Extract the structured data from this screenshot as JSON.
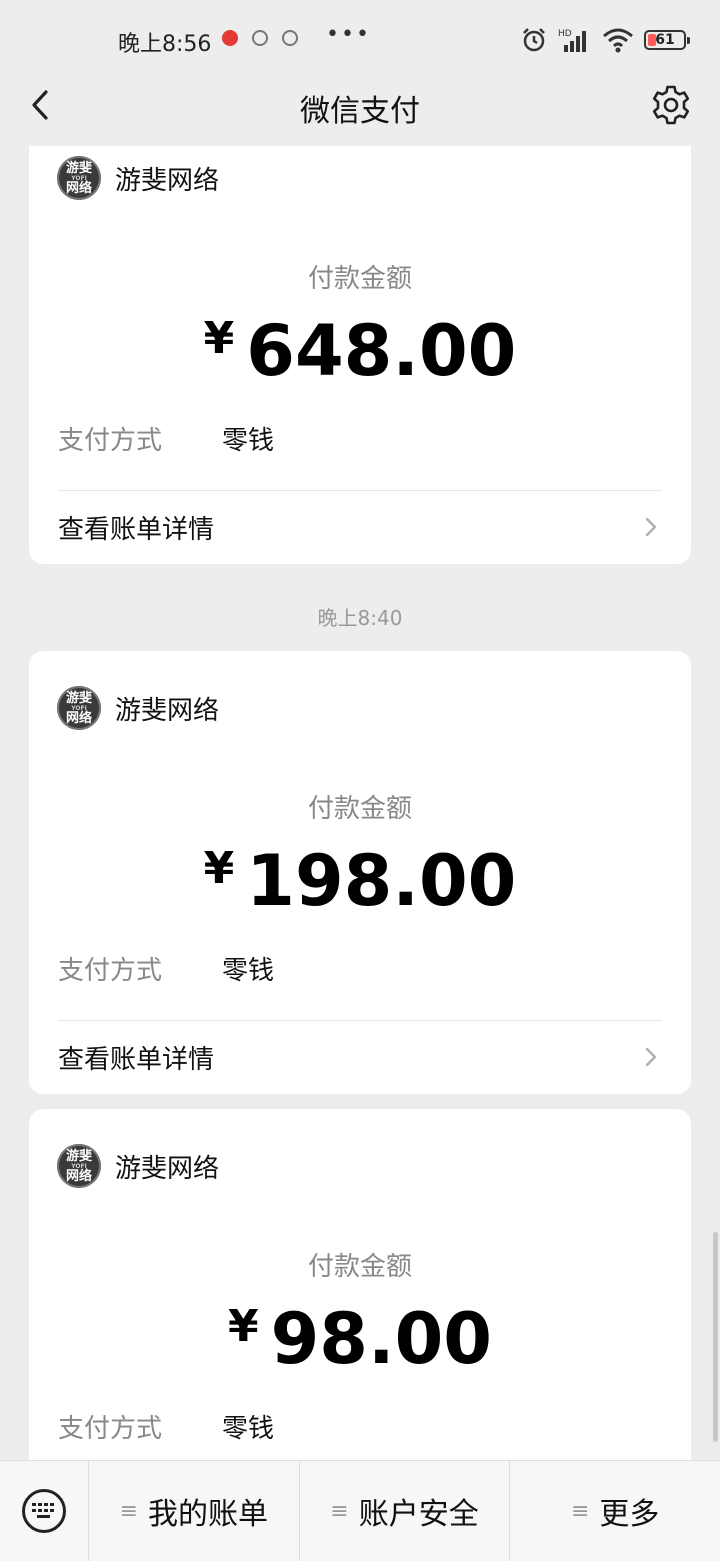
{
  "status": {
    "time": "晚上8:56",
    "battery": "61"
  },
  "nav": {
    "title": "微信支付"
  },
  "cards": [
    {
      "merchant": "游斐网络",
      "amount_label": "付款金额",
      "currency": "¥",
      "amount": "648.00",
      "pay_method_label": "支付方式",
      "pay_method": "零钱",
      "detail_label": "查看账单详情"
    },
    {
      "merchant": "游斐网络",
      "amount_label": "付款金额",
      "currency": "¥",
      "amount": "198.00",
      "pay_method_label": "支付方式",
      "pay_method": "零钱",
      "detail_label": "查看账单详情"
    },
    {
      "merchant": "游斐网络",
      "amount_label": "付款金额",
      "currency": "¥",
      "amount": "98.00",
      "pay_method_label": "支付方式",
      "pay_method": "零钱"
    }
  ],
  "timestamp": "晚上8:40",
  "logo": {
    "line1": "游斐",
    "line2": "YOFI",
    "line3": "网络"
  },
  "bottom_menu": [
    {
      "label": "我的账单"
    },
    {
      "label": "账户安全"
    },
    {
      "label": "更多"
    }
  ],
  "colors": {
    "background": "#ededed",
    "card": "#ffffff",
    "muted_text": "#888888"
  }
}
